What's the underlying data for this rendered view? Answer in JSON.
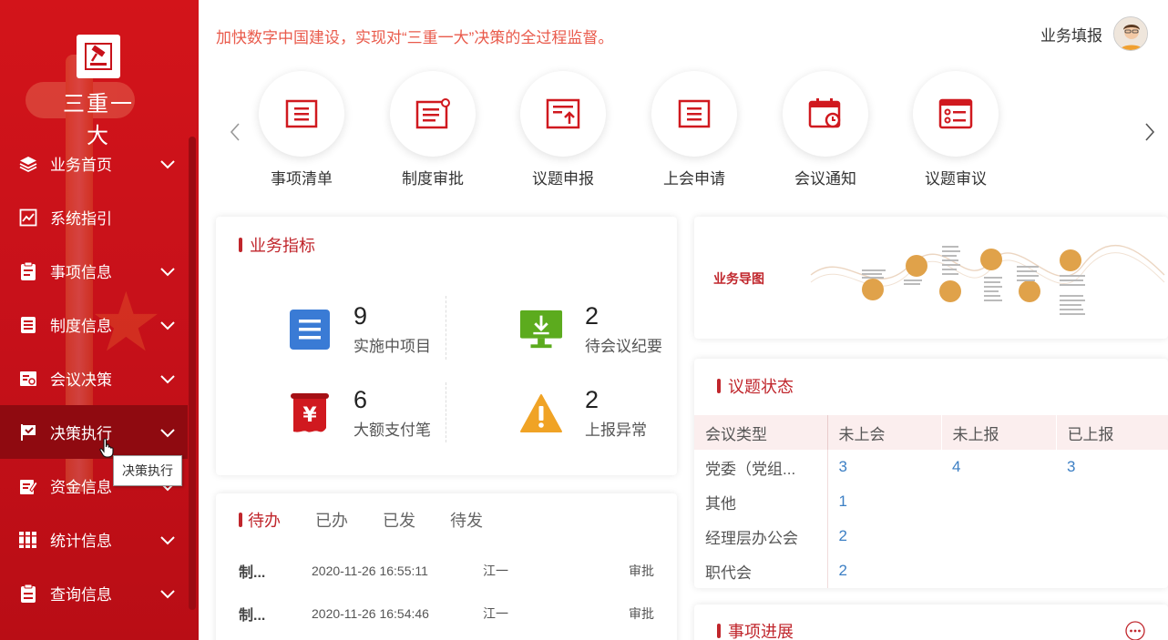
{
  "app": {
    "logo_text": "三重一大"
  },
  "header": {
    "slogan": "加快数字中国建设，实现对“三重一大”决策的全过程监督。",
    "user_label": "业务填报"
  },
  "sidebar": {
    "items": [
      {
        "label": "业务首页",
        "icon": "layers-icon",
        "has_chevron": true
      },
      {
        "label": "系统指引",
        "icon": "trend-chart-icon",
        "has_chevron": false
      },
      {
        "label": "事项信息",
        "icon": "clipboard-icon",
        "has_chevron": true
      },
      {
        "label": "制度信息",
        "icon": "list-doc-icon",
        "has_chevron": true
      },
      {
        "label": "会议决策",
        "icon": "meeting-icon",
        "has_chevron": true
      },
      {
        "label": "决策执行",
        "icon": "flag-check-icon",
        "has_chevron": true,
        "active": true
      },
      {
        "label": "资金信息",
        "icon": "edit-doc-icon",
        "has_chevron": true
      },
      {
        "label": "统计信息",
        "icon": "books-icon",
        "has_chevron": true
      },
      {
        "label": "查询信息",
        "icon": "query-doc-icon",
        "has_chevron": true
      }
    ],
    "tooltip": "决策执行"
  },
  "shortcuts": [
    {
      "label": "事项清单",
      "icon": "list-icon"
    },
    {
      "label": "制度审批",
      "icon": "doc-approve-icon"
    },
    {
      "label": "议题申报",
      "icon": "upload-doc-icon"
    },
    {
      "label": "上会申请",
      "icon": "doc-list-icon"
    },
    {
      "label": "会议通知",
      "icon": "calendar-clock-icon"
    },
    {
      "label": "议题审议",
      "icon": "review-list-icon"
    }
  ],
  "metrics": {
    "title": "业务指标",
    "items": [
      {
        "value": "9",
        "label": "实施中项目",
        "icon": "doc-blue-icon",
        "color": "#3a7bd5"
      },
      {
        "value": "2",
        "label": "待会议纪要",
        "icon": "monitor-download-icon",
        "color": "#5cab1e"
      },
      {
        "value": "6",
        "label": "大额支付笔",
        "icon": "yuan-scroll-icon",
        "color": "#d0191f"
      },
      {
        "value": "2",
        "label": "上报异常",
        "icon": "warning-icon",
        "color": "#f0a325"
      }
    ]
  },
  "todo": {
    "tabs": [
      "待办",
      "已办",
      "已发",
      "待发"
    ],
    "rows": [
      {
        "title": "制...",
        "time": "2020-11-26 16:55:11",
        "user": "江一",
        "type": "审批"
      },
      {
        "title": "制...",
        "time": "2020-11-26 16:54:46",
        "user": "江一",
        "type": "审批"
      }
    ]
  },
  "guide": {
    "title": "业务导图"
  },
  "issue_status": {
    "title": "议题状态",
    "headers": [
      "会议类型",
      "未上会",
      "未上报",
      "已上报"
    ],
    "rows": [
      [
        "党委（党组...",
        "3",
        "4",
        "3"
      ],
      [
        "其他",
        "1",
        "",
        ""
      ],
      [
        "经理层办公会",
        "2",
        "",
        ""
      ],
      [
        "职代会",
        "2",
        "",
        ""
      ]
    ]
  },
  "progress": {
    "title": "事项进展"
  },
  "colors": {
    "brand_red": "#c8111a",
    "accent_red": "#c0262c",
    "link_blue": "#3c7fc4"
  }
}
